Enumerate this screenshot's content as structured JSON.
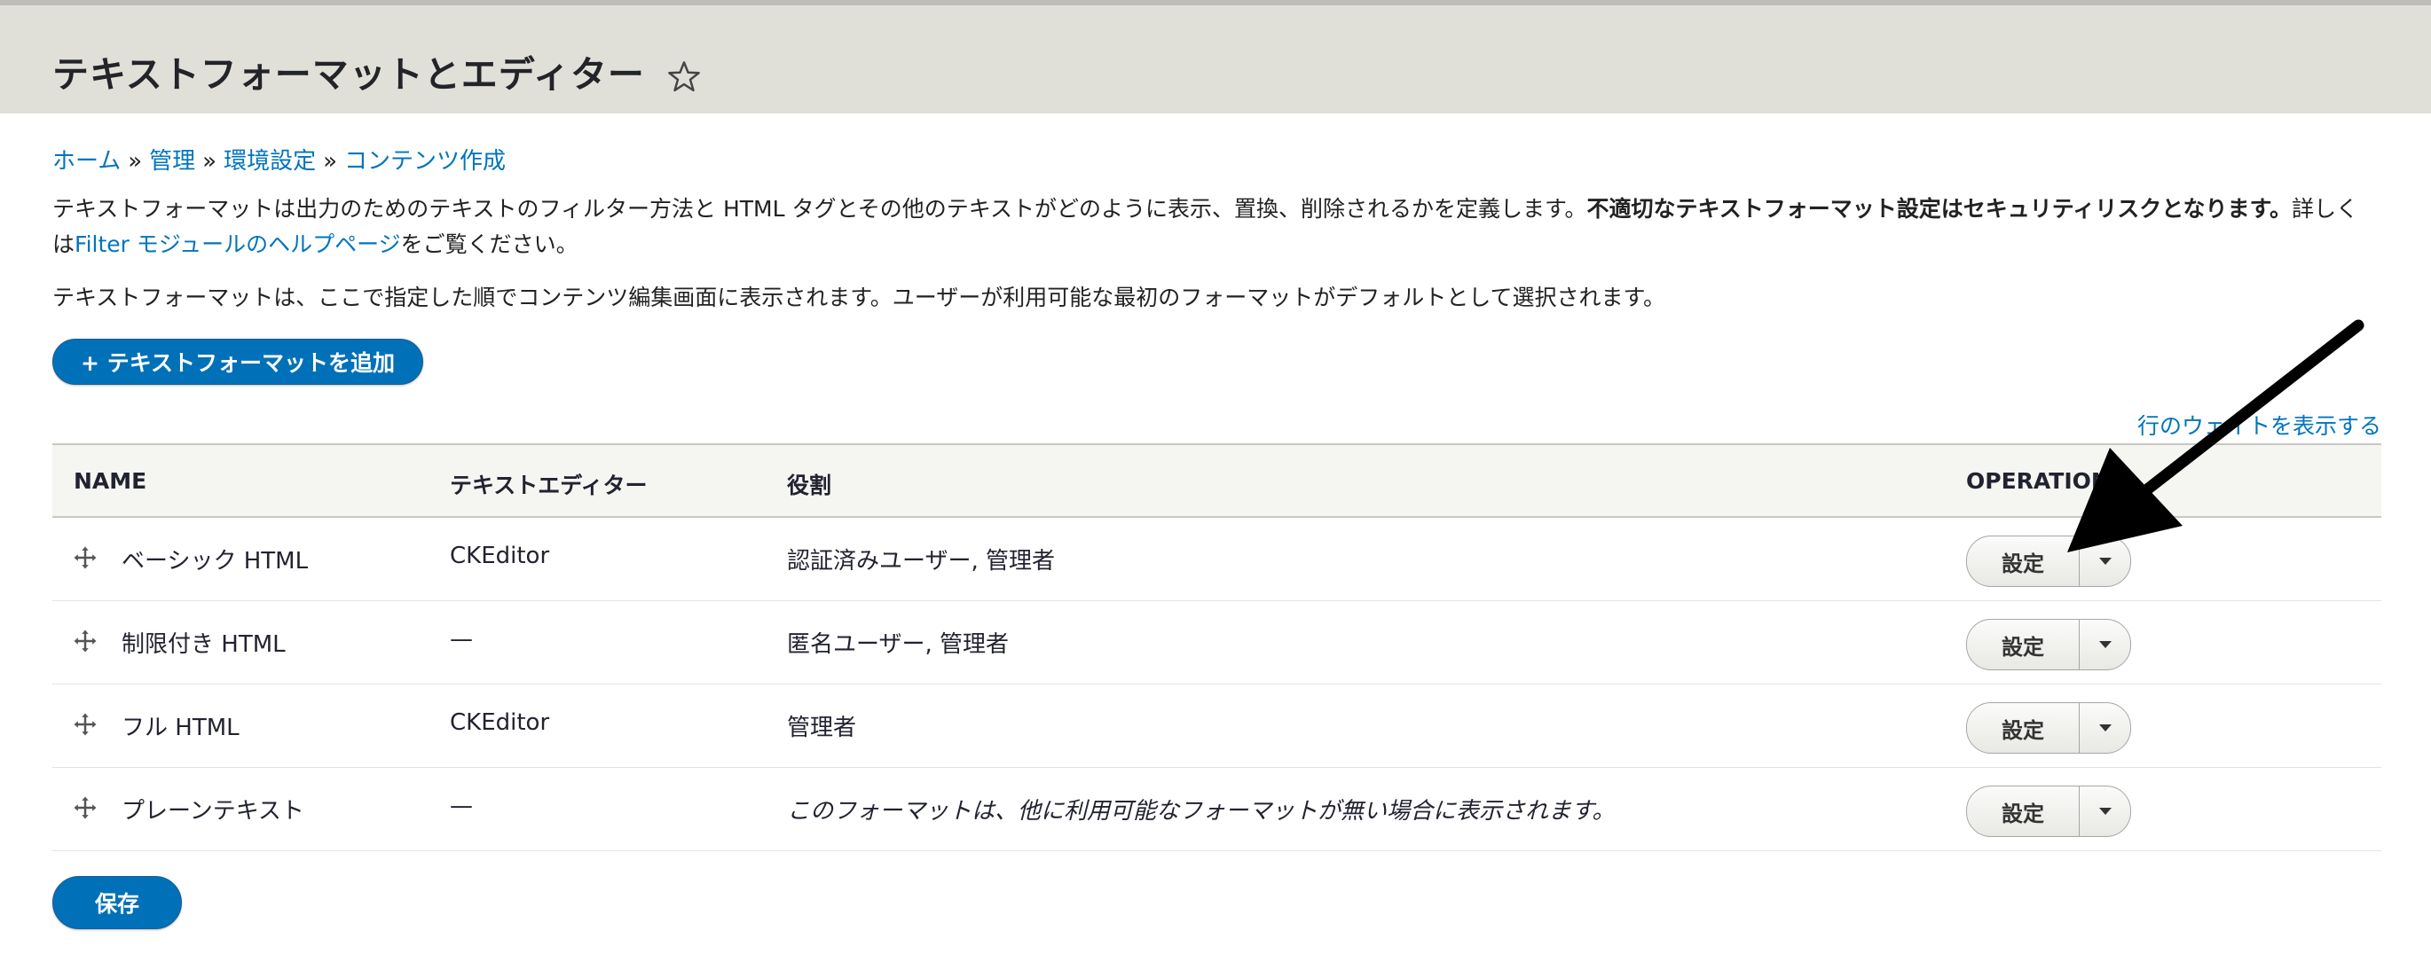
{
  "page": {
    "title": "テキストフォーマットとエディター"
  },
  "breadcrumb": [
    {
      "label": "ホーム"
    },
    {
      "label": "管理"
    },
    {
      "label": "環境設定"
    },
    {
      "label": "コンテンツ作成"
    }
  ],
  "breadcrumb_separator": "»",
  "description": {
    "part1": "テキストフォーマットは出力のためのテキストのフィルター方法と HTML タグとその他のテキストがどのように表示、置換、削除されるかを定義します。",
    "warning": "不適切なテキストフォーマット設定はセキュリティリスクとなります。",
    "part2": "詳しくは",
    "help_link": "Filter モジュールのヘルプページ",
    "part3": "をご覧ください。",
    "order_note": "テキストフォーマットは、ここで指定した順でコンテンツ編集画面に表示されます。ユーザーが利用可能な最初のフォーマットがデフォルトとして選択されます。"
  },
  "actions": {
    "add_format": "+ テキストフォーマットを追加",
    "show_weights": "行のウェイトを表示する",
    "save": "保存"
  },
  "table": {
    "headers": {
      "name": "NAME",
      "editor": "テキストエディター",
      "roles": "役割",
      "operations": "OPERATIONS"
    },
    "rows": [
      {
        "name": "ベーシック HTML",
        "editor": "CKEditor",
        "roles": "認証済みユーザー, 管理者",
        "operation": "設定",
        "roles_italic": false
      },
      {
        "name": "制限付き HTML",
        "editor": "—",
        "roles": "匿名ユーザー, 管理者",
        "operation": "設定",
        "roles_italic": false
      },
      {
        "name": "フル HTML",
        "editor": "CKEditor",
        "roles": "管理者",
        "operation": "設定",
        "roles_italic": false
      },
      {
        "name": "プレーンテキスト",
        "editor": "—",
        "roles": "このフォーマットは、他に利用可能なフォーマットが無い場合に表示されます。",
        "operation": "設定",
        "roles_italic": true
      }
    ]
  },
  "icons": {
    "favorite": "star-outline-icon",
    "drag": "drag-handle-icon",
    "dropdown": "triangle-down-icon"
  },
  "colors": {
    "link": "#0074bd",
    "primary_button": "#0071b8",
    "header_bg": "#e0e0d8"
  }
}
